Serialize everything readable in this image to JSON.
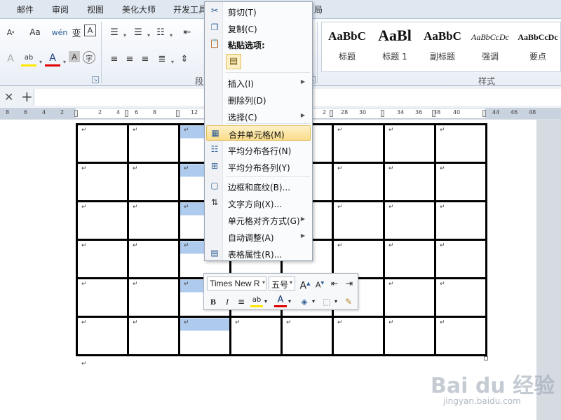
{
  "ribbon_tabs": [
    "邮件",
    "审阅",
    "视图",
    "美化大师",
    "开发工具",
    "局"
  ],
  "ribbon": {
    "paragraph_group_label": "段",
    "styles_group_label": "样式",
    "styles": [
      {
        "sample": "AaBbC",
        "name": "标题"
      },
      {
        "sample": "AaBl",
        "name": "标题 1"
      },
      {
        "sample": "AaBbC",
        "name": "副标题"
      },
      {
        "sample": "AaBbCcDc",
        "name": "强调"
      },
      {
        "sample": "AaBbCcDc",
        "name": "要点"
      }
    ],
    "icons": {
      "change_case": "Aa",
      "font_color": "A",
      "highlight": "ab",
      "pinyin": "wén",
      "phonetic_char": "变",
      "char_border": "A",
      "char_shading": "A",
      "enclosed_char": "字"
    }
  },
  "ruler": {
    "numbers": [
      "8",
      "6",
      "4",
      "2",
      "2",
      "4",
      "6",
      "8",
      "12",
      "2",
      "28",
      "30",
      "34",
      "36",
      "38",
      "40",
      "44",
      "46",
      "48"
    ]
  },
  "context_menu": {
    "items": [
      {
        "label": "剪切(T)",
        "icon": "scissors-icon"
      },
      {
        "label": "复制(C)",
        "icon": "copy-icon"
      },
      {
        "label": "粘贴选项:",
        "icon": "paste-icon",
        "bold": true
      },
      {
        "label": "插入(I)",
        "icon": "",
        "submenu": true
      },
      {
        "label": "删除列(D)",
        "icon": ""
      },
      {
        "label": "选择(C)",
        "icon": "",
        "submenu": true
      },
      {
        "label": "合并单元格(M)",
        "icon": "merge-cells-icon",
        "highlighted": true
      },
      {
        "label": "平均分布各行(N)",
        "icon": "distribute-rows-icon"
      },
      {
        "label": "平均分布各列(Y)",
        "icon": "distribute-columns-icon"
      },
      {
        "label": "边框和底纹(B)...",
        "icon": "borders-icon"
      },
      {
        "label": "文字方向(X)...",
        "icon": "text-direction-icon"
      },
      {
        "label": "单元格对齐方式(G)",
        "icon": "",
        "submenu": true
      },
      {
        "label": "自动调整(A)",
        "icon": "",
        "submenu": true
      },
      {
        "label": "表格属性(R)...",
        "icon": "table-properties-icon"
      }
    ]
  },
  "mini_toolbar": {
    "font": "Times New R",
    "size": "五号",
    "bold": "B",
    "italic": "I",
    "highlight": "ab",
    "font_color": "A"
  },
  "table": {
    "rows": 6,
    "cols": 8,
    "selected_col": 2,
    "cell_mark": "↵"
  },
  "paragraph_mark": "↵",
  "watermark": {
    "logo": "Bai du 经验",
    "url": "jingyan.baidu.com"
  }
}
